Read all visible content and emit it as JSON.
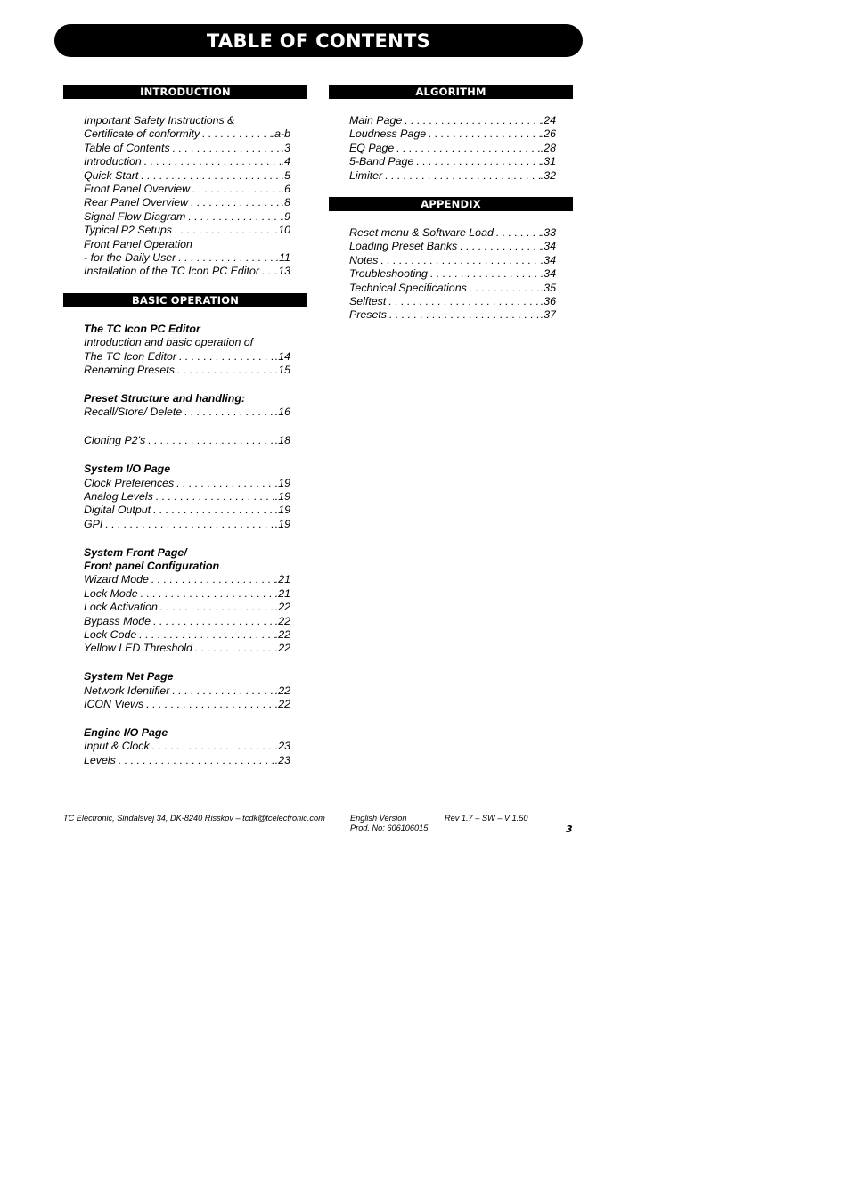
{
  "title": "TABLE OF CONTENTS",
  "sections": {
    "introduction": {
      "label": "INTRODUCTION",
      "items": [
        {
          "type": "text",
          "title": "Important Safety Instructions &"
        },
        {
          "type": "entry",
          "title": "Certificate of conformity",
          "page": ".a-b"
        },
        {
          "type": "entry",
          "title": "Table of Contents",
          "page": ".3"
        },
        {
          "type": "entry",
          "title": "Introduction",
          "page": ".4"
        },
        {
          "type": "entry",
          "title": "Quick Start",
          "page": ".5"
        },
        {
          "type": "entry",
          "title": "Front Panel Overview",
          "page": ".6"
        },
        {
          "type": "entry",
          "title": "Rear Panel Overview",
          "page": ".8"
        },
        {
          "type": "entry",
          "title": "Signal Flow Diagram",
          "page": ".9"
        },
        {
          "type": "entry",
          "title": "Typical P2 Setups",
          "page": ".10"
        },
        {
          "type": "text",
          "title": "Front Panel Operation"
        },
        {
          "type": "entry",
          "title": "- for the Daily User",
          "page": ".11"
        },
        {
          "type": "entry",
          "title": "Installation of the TC Icon PC Editor",
          "page": ".13"
        }
      ]
    },
    "basic_operation": {
      "label": "BASIC OPERATION",
      "items": [
        {
          "type": "heading",
          "title": "The TC Icon PC Editor"
        },
        {
          "type": "text",
          "title": "Introduction and basic operation of"
        },
        {
          "type": "entry",
          "title": "The TC Icon Editor",
          "page": ".14"
        },
        {
          "type": "entry",
          "title": "Renaming Presets",
          "page": ".15"
        },
        {
          "type": "spacer"
        },
        {
          "type": "heading",
          "title": "Preset Structure and handling:"
        },
        {
          "type": "entry",
          "title": "Recall/Store/ Delete",
          "page": ".16"
        },
        {
          "type": "spacer"
        },
        {
          "type": "entry",
          "title": "Cloning P2's",
          "page": ".18"
        },
        {
          "type": "spacer"
        },
        {
          "type": "heading",
          "title": "System I/O Page"
        },
        {
          "type": "entry",
          "title": "Clock Preferences",
          "page": ".19"
        },
        {
          "type": "entry",
          "title": "Analog Levels",
          "page": ".19"
        },
        {
          "type": "entry",
          "title": "Digital Output",
          "page": ".19"
        },
        {
          "type": "entry",
          "title": "GPI",
          "page": ".19"
        },
        {
          "type": "spacer"
        },
        {
          "type": "heading",
          "title": "System Front Page/"
        },
        {
          "type": "heading",
          "title": "Front panel Configuration"
        },
        {
          "type": "entry",
          "title": "Wizard Mode",
          "page": ".21"
        },
        {
          "type": "entry",
          "title": "Lock Mode",
          "page": ".21"
        },
        {
          "type": "entry",
          "title": "Lock Activation",
          "page": ".22"
        },
        {
          "type": "entry",
          "title": "Bypass Mode",
          "page": ".22"
        },
        {
          "type": "entry",
          "title": "Lock Code",
          "page": ".22"
        },
        {
          "type": "entry",
          "title": "Yellow LED Threshold",
          "page": ".22"
        },
        {
          "type": "spacer"
        },
        {
          "type": "heading",
          "title": "System Net Page"
        },
        {
          "type": "entry",
          "title": "Network Identifier",
          "page": ".22"
        },
        {
          "type": "entry",
          "title": "ICON Views",
          "page": ".22"
        },
        {
          "type": "spacer"
        },
        {
          "type": "heading",
          "title": "Engine I/O Page"
        },
        {
          "type": "entry",
          "title": "Input & Clock",
          "page": ".23"
        },
        {
          "type": "entry",
          "title": "Levels",
          "page": ".23"
        }
      ]
    },
    "algorithm": {
      "label": "ALGORITHM",
      "items": [
        {
          "type": "entry",
          "title": "Main Page",
          "page": ".24"
        },
        {
          "type": "entry",
          "title": "Loudness Page",
          "page": ".26"
        },
        {
          "type": "entry",
          "title": "EQ Page",
          "page": ".28"
        },
        {
          "type": "entry",
          "title": "5-Band Page",
          "page": ".31"
        },
        {
          "type": "entry",
          "title": "Limiter",
          "page": ".32"
        }
      ]
    },
    "appendix": {
      "label": "APPENDIX",
      "items": [
        {
          "type": "entry",
          "title": "Reset menu & Software Load",
          "page": ".33"
        },
        {
          "type": "entry",
          "title": "Loading Preset Banks",
          "page": ".34"
        },
        {
          "type": "entry",
          "title": "Notes",
          "page": ".34"
        },
        {
          "type": "entry",
          "title": "Troubleshooting",
          "page": ".34"
        },
        {
          "type": "entry",
          "title": "Technical Specifications",
          "page": ".35"
        },
        {
          "type": "entry",
          "title": "Selftest",
          "page": ".36"
        },
        {
          "type": "entry",
          "title": "Presets",
          "page": ".37"
        }
      ]
    }
  },
  "footer": {
    "address": "TC Electronic, Sindalsvej 34, DK-8240 Risskov – tcdk@tcelectronic.com",
    "version": "English Version",
    "prod_no": "Prod. No: 606106015",
    "revision": "Rev 1.7 – SW – V 1.50",
    "page_number": "3"
  }
}
